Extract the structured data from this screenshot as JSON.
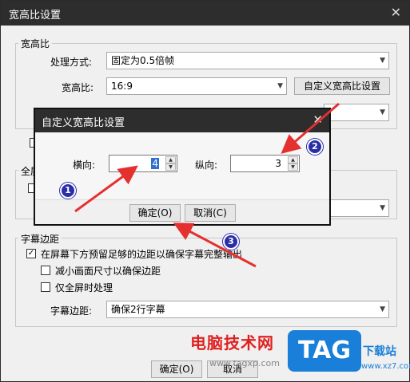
{
  "window": {
    "title": "宽高比设置",
    "close_glyph": "✕"
  },
  "aspect_group": {
    "label": "宽高比",
    "method_label": "处理方式:",
    "method_value": "固定为0.5倍帧",
    "ratio_label": "宽高比:",
    "ratio_value": "16:9",
    "custom_button": "自定义宽高比设置"
  },
  "fullscreen_group": {
    "label": "全屏"
  },
  "subtitle_group": {
    "label": "字幕边距",
    "reserve_margin_label": "在屏幕下方预留足够的边距以确保字幕完整输出",
    "reserve_margin_checked": true,
    "shrink_label": "减小画面尺寸以确保边距",
    "shrink_checked": false,
    "fullscreen_only_label": "仅全屏时处理",
    "fullscreen_only_checked": false,
    "margin_label": "字幕边距:",
    "margin_value": "确保2行字幕"
  },
  "footer": {
    "ok": "确定(O)",
    "cancel": "取消"
  },
  "dialog": {
    "title": "自定义宽高比设置",
    "close_glyph": "✕",
    "horizontal_label": "横向:",
    "horizontal_value": "4",
    "vertical_label": "纵向:",
    "vertical_value": "3",
    "ok": "确定(O)",
    "cancel": "取消(C)"
  },
  "markers": [
    "1",
    "2",
    "3"
  ],
  "watermark": {
    "site_name": "电脑技术网",
    "url": "www.tagxp.com",
    "logo": "TAG",
    "download": "下载站",
    "download_url": "www.xz7.com"
  },
  "colors": {
    "titlebar": "#2d2d2d",
    "selection": "#2f6fd1",
    "marker": "#2a2fa8",
    "arrow": "#e53030",
    "watermark_red": "#e02020",
    "logo_blue": "#1a7fd8"
  }
}
